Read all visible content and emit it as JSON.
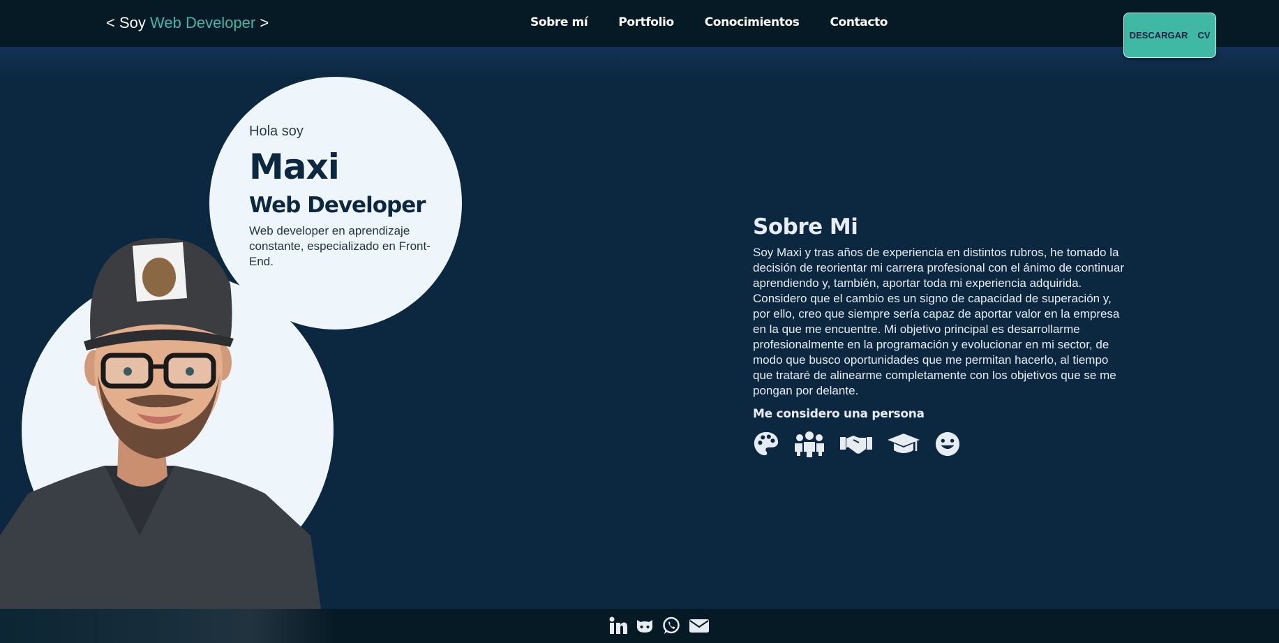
{
  "header": {
    "logo_prefix": "< Soy",
    "logo_accent": "Web Developer",
    "logo_suffix": ">",
    "nav": [
      "Sobre mí",
      "Portfolio",
      "Conocimientos",
      "Contacto"
    ],
    "cv_button": {
      "word1": "DESCARGAR",
      "word2": "CV"
    }
  },
  "hero": {
    "greeting": "Hola soy",
    "name": "Maxi",
    "role": "Web Developer",
    "description": "Web developer en aprendizaje constante, especializado en Front-End."
  },
  "about": {
    "title": "Sobre Mi",
    "text": "Soy Maxi y tras años de experiencia en distintos rubros, he tomado la decisión de reorientar mi carrera profesional con el ánimo de continuar aprendiendo y, también, aportar toda mi experiencia adquirida. Considero que el cambio es un signo de capacidad de superación y, por ello, creo que siempre sería capaz de aportar valor en la empresa en la que me encuentre. Mi objetivo principal es desarrollarme profesionalmente en la programación y evolucionar en mi sector, de modo que busco oportunidades que me permitan hacerlo, al tiempo que trataré de alinearme completamente con los objetivos que se me pongan por delante.",
    "subtitle": "Me considero una persona",
    "trait_icons": [
      "palette-icon",
      "team-icon",
      "handshake-icon",
      "graduation-cap-icon",
      "smile-icon"
    ]
  },
  "footer": {
    "social_icons": [
      "linkedin-icon",
      "github-icon",
      "whatsapp-icon",
      "email-icon"
    ]
  },
  "colors": {
    "background": "#0c2840",
    "header": "#061a26",
    "accent": "#3fb9a3",
    "circle": "#eef6fc"
  }
}
